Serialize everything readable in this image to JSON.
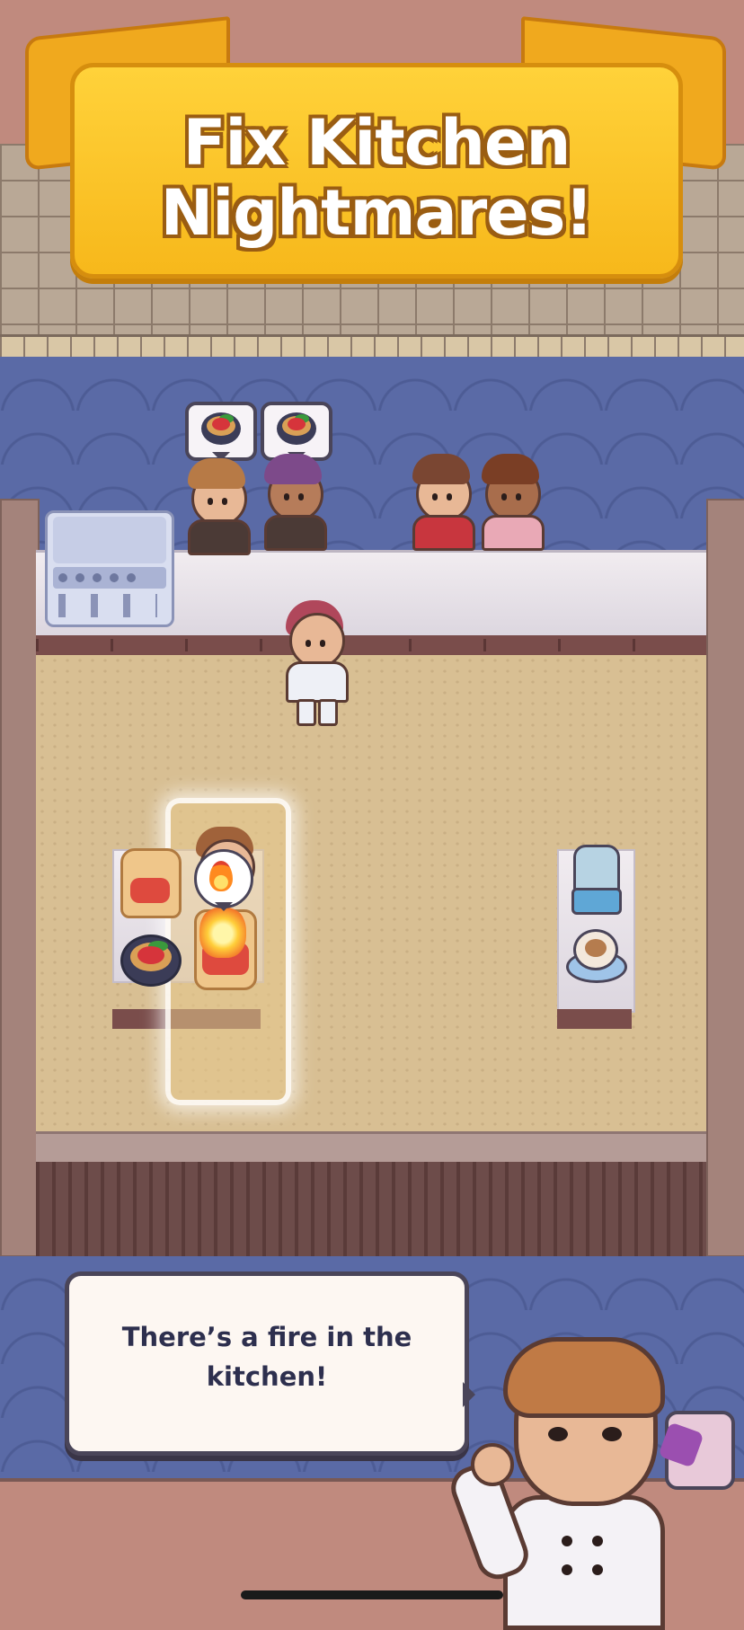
{
  "banner": {
    "title_line1": "Fix Kitchen",
    "title_line2": "Nightmares!"
  },
  "dialogue": {
    "text": "There’s a fire in the kitchen!"
  },
  "colors": {
    "banner_fill": "#ffd23a",
    "banner_outline": "#d68e0e",
    "floor_blue": "#5a6aa6",
    "kitchen_floor": "#d8bf93",
    "dialogue_text": "#2d2f4e"
  },
  "icons": {
    "order": "dish-icon",
    "alert": "fire-icon"
  },
  "customers": [
    {
      "name": "customer-1",
      "hair": "#b77a46",
      "shirt": "#4b3a36"
    },
    {
      "name": "customer-2",
      "hair": "#7d4a8a",
      "shirt": "#4b3a36"
    },
    {
      "name": "customer-3",
      "hair": "#7a4632",
      "shirt": "#c8363e"
    },
    {
      "name": "customer-4",
      "hair": "#7a3e25",
      "shirt": "#e9a9b6"
    }
  ]
}
